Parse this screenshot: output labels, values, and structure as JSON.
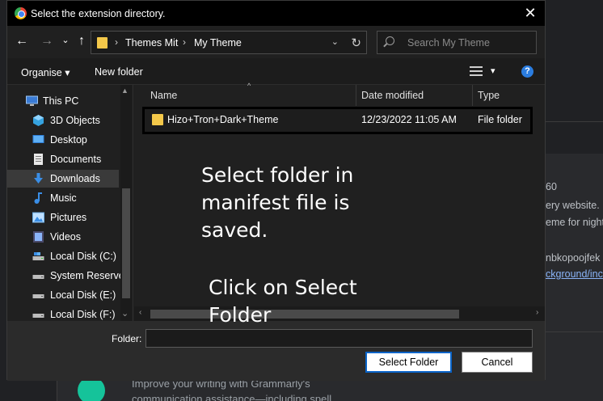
{
  "dialog": {
    "title": "Select the extension directory.",
    "close_glyph": "✕"
  },
  "nav": {
    "back_glyph": "←",
    "forward_glyph": "→",
    "recent_glyph": "⌄",
    "up_glyph": "↑",
    "breadcrumbs": [
      "Themes Mit",
      "My Theme"
    ],
    "crumb_sep": "›",
    "dropdown_glyph": "⌄",
    "refresh_glyph": "↻",
    "search_placeholder": "Search My Theme"
  },
  "toolbar": {
    "organise_label": "Organise ▾",
    "new_folder_label": "New folder",
    "view_dropdown_glyph": "▾",
    "help_glyph": "?"
  },
  "sidebar": {
    "items": [
      {
        "label": "This PC",
        "icon": "pc-icon"
      },
      {
        "label": "3D Objects",
        "icon": "cube-icon"
      },
      {
        "label": "Desktop",
        "icon": "desktop-icon"
      },
      {
        "label": "Documents",
        "icon": "documents-icon"
      },
      {
        "label": "Downloads",
        "icon": "download-icon"
      },
      {
        "label": "Music",
        "icon": "music-icon"
      },
      {
        "label": "Pictures",
        "icon": "pictures-icon"
      },
      {
        "label": "Videos",
        "icon": "videos-icon"
      },
      {
        "label": "Local Disk (C:)",
        "icon": "drive-icon"
      },
      {
        "label": "System Reserved",
        "icon": "drive-icon"
      },
      {
        "label": "Local Disk (E:)",
        "icon": "drive-icon"
      },
      {
        "label": "Local Disk (F:)",
        "icon": "drive-icon"
      }
    ],
    "selected": "Downloads",
    "scroll_up_glyph": "▲",
    "scroll_down_glyph": "⌄"
  },
  "files": {
    "columns": {
      "name": "Name",
      "date": "Date modified",
      "type": "Type"
    },
    "sort_glyph": "^",
    "rows": [
      {
        "name": "Hizo+Tron+Dark+Theme",
        "date": "12/23/2022 11:05 AM",
        "type": "File folder"
      }
    ],
    "scroll_left_glyph": "‹",
    "scroll_right_glyph": "›"
  },
  "annotations": {
    "line1": "Select folder in",
    "line2": "manifest file is",
    "line3": "saved.",
    "line4": "Click on Select",
    "line5": "Folder"
  },
  "bottom": {
    "folder_label": "Folder:",
    "folder_value": "",
    "select_button": "Select Folder",
    "cancel_button": "Cancel"
  },
  "background": {
    "text1": "60",
    "text2": "ery website.",
    "text3": "eme for night",
    "text4": "nbkopoojfek",
    "text5": "ckground/inc",
    "text6": "Improve your writing with Grammarly's",
    "text7": "communication assistance—including spell"
  },
  "colors": {
    "accent": "#0a64c8",
    "folder": "#f4c84a",
    "help": "#2b7de0"
  }
}
